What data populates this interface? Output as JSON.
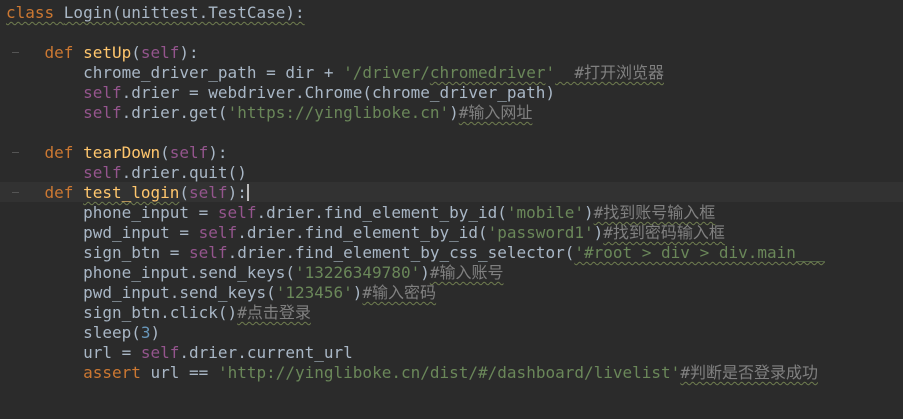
{
  "code_lines": [
    [
      {
        "t": "class ",
        "c": "kw",
        "u": true
      },
      {
        "t": "Login(unittest.TestCase):",
        "c": "df",
        "u": true
      }
    ],
    [],
    [
      {
        "t": "    ",
        "c": "df"
      },
      {
        "t": "def ",
        "c": "kw"
      },
      {
        "t": "setUp",
        "c": "fn"
      },
      {
        "t": "(",
        "c": "df"
      },
      {
        "t": "self",
        "c": "slf"
      },
      {
        "t": "):",
        "c": "df"
      }
    ],
    [
      {
        "t": "        chrome_driver_path = dir + ",
        "c": "df"
      },
      {
        "t": "'/driver/",
        "c": "str"
      },
      {
        "t": "chromedriver",
        "c": "str",
        "u": true
      },
      {
        "t": "'",
        "c": "str"
      },
      {
        "t": "  #打开浏览器",
        "c": "cm",
        "u": true
      }
    ],
    [
      {
        "t": "        ",
        "c": "df"
      },
      {
        "t": "self",
        "c": "slf"
      },
      {
        "t": ".drier = webdriver.Chrome(chrome_driver_path)",
        "c": "df"
      }
    ],
    [
      {
        "t": "        ",
        "c": "df"
      },
      {
        "t": "self",
        "c": "slf"
      },
      {
        "t": ".drier.get(",
        "c": "df"
      },
      {
        "t": "'https://yingliboke.cn'",
        "c": "str"
      },
      {
        "t": ")",
        "c": "df"
      },
      {
        "t": "#输入网址",
        "c": "cm",
        "u": true
      }
    ],
    [],
    [
      {
        "t": "    ",
        "c": "df"
      },
      {
        "t": "def ",
        "c": "kw"
      },
      {
        "t": "tearDown",
        "c": "fn"
      },
      {
        "t": "(",
        "c": "df"
      },
      {
        "t": "self",
        "c": "slf"
      },
      {
        "t": "):",
        "c": "df"
      }
    ],
    [
      {
        "t": "        ",
        "c": "df"
      },
      {
        "t": "self",
        "c": "slf"
      },
      {
        "t": ".drier.quit()",
        "c": "df"
      }
    ],
    [
      {
        "t": "    ",
        "c": "df"
      },
      {
        "t": "def ",
        "c": "kw"
      },
      {
        "t": "test_login",
        "c": "fn",
        "u": true
      },
      {
        "t": "(",
        "c": "df"
      },
      {
        "t": "self",
        "c": "slf"
      },
      {
        "t": "):",
        "c": "df"
      },
      {
        "caret": true
      }
    ],
    [
      {
        "t": "        phone_input = ",
        "c": "df"
      },
      {
        "t": "self",
        "c": "slf"
      },
      {
        "t": ".drier.find_element_by_id(",
        "c": "df"
      },
      {
        "t": "'mobile'",
        "c": "str"
      },
      {
        "t": ")",
        "c": "df"
      },
      {
        "t": "#找到账号输入框",
        "c": "cm",
        "u": true
      }
    ],
    [
      {
        "t": "        pwd_input = ",
        "c": "df"
      },
      {
        "t": "self",
        "c": "slf"
      },
      {
        "t": ".drier.find_element_by_id(",
        "c": "df"
      },
      {
        "t": "'password1'",
        "c": "str"
      },
      {
        "t": ")",
        "c": "df"
      },
      {
        "t": "#找到密码输入框",
        "c": "cm",
        "u": true
      }
    ],
    [
      {
        "t": "        sign_btn = ",
        "c": "df"
      },
      {
        "t": "self",
        "c": "slf"
      },
      {
        "t": ".drier.find_element_by_css_selector(",
        "c": "df"
      },
      {
        "t": "'#root > div > div.main___",
        "c": "str",
        "u": true
      }
    ],
    [
      {
        "t": "        phone_input.send_keys(",
        "c": "df"
      },
      {
        "t": "'13226349780'",
        "c": "str"
      },
      {
        "t": ")",
        "c": "df"
      },
      {
        "t": "#输入账号",
        "c": "cm",
        "u": true
      }
    ],
    [
      {
        "t": "        pwd_input.send_keys(",
        "c": "df"
      },
      {
        "t": "'123456'",
        "c": "str"
      },
      {
        "t": ")",
        "c": "df"
      },
      {
        "t": "#输入密码",
        "c": "cm",
        "u": true
      }
    ],
    [
      {
        "t": "        sign_btn.click()",
        "c": "df"
      },
      {
        "t": "#点击登录",
        "c": "cm",
        "u": true
      }
    ],
    [
      {
        "t": "        sleep(",
        "c": "df"
      },
      {
        "t": "3",
        "c": "num"
      },
      {
        "t": ")",
        "c": "df"
      }
    ],
    [
      {
        "t": "        url = ",
        "c": "df"
      },
      {
        "t": "self",
        "c": "slf"
      },
      {
        "t": ".drier.current_url",
        "c": "df"
      }
    ],
    [
      {
        "t": "        ",
        "c": "df"
      },
      {
        "t": "assert ",
        "c": "kw"
      },
      {
        "t": "url == ",
        "c": "df"
      },
      {
        "t": "'http://yingliboke.cn/dist/#/dashboard/livelist'",
        "c": "str"
      },
      {
        "t": "#判断是否登录成功",
        "c": "cm",
        "u": true
      }
    ]
  ]
}
